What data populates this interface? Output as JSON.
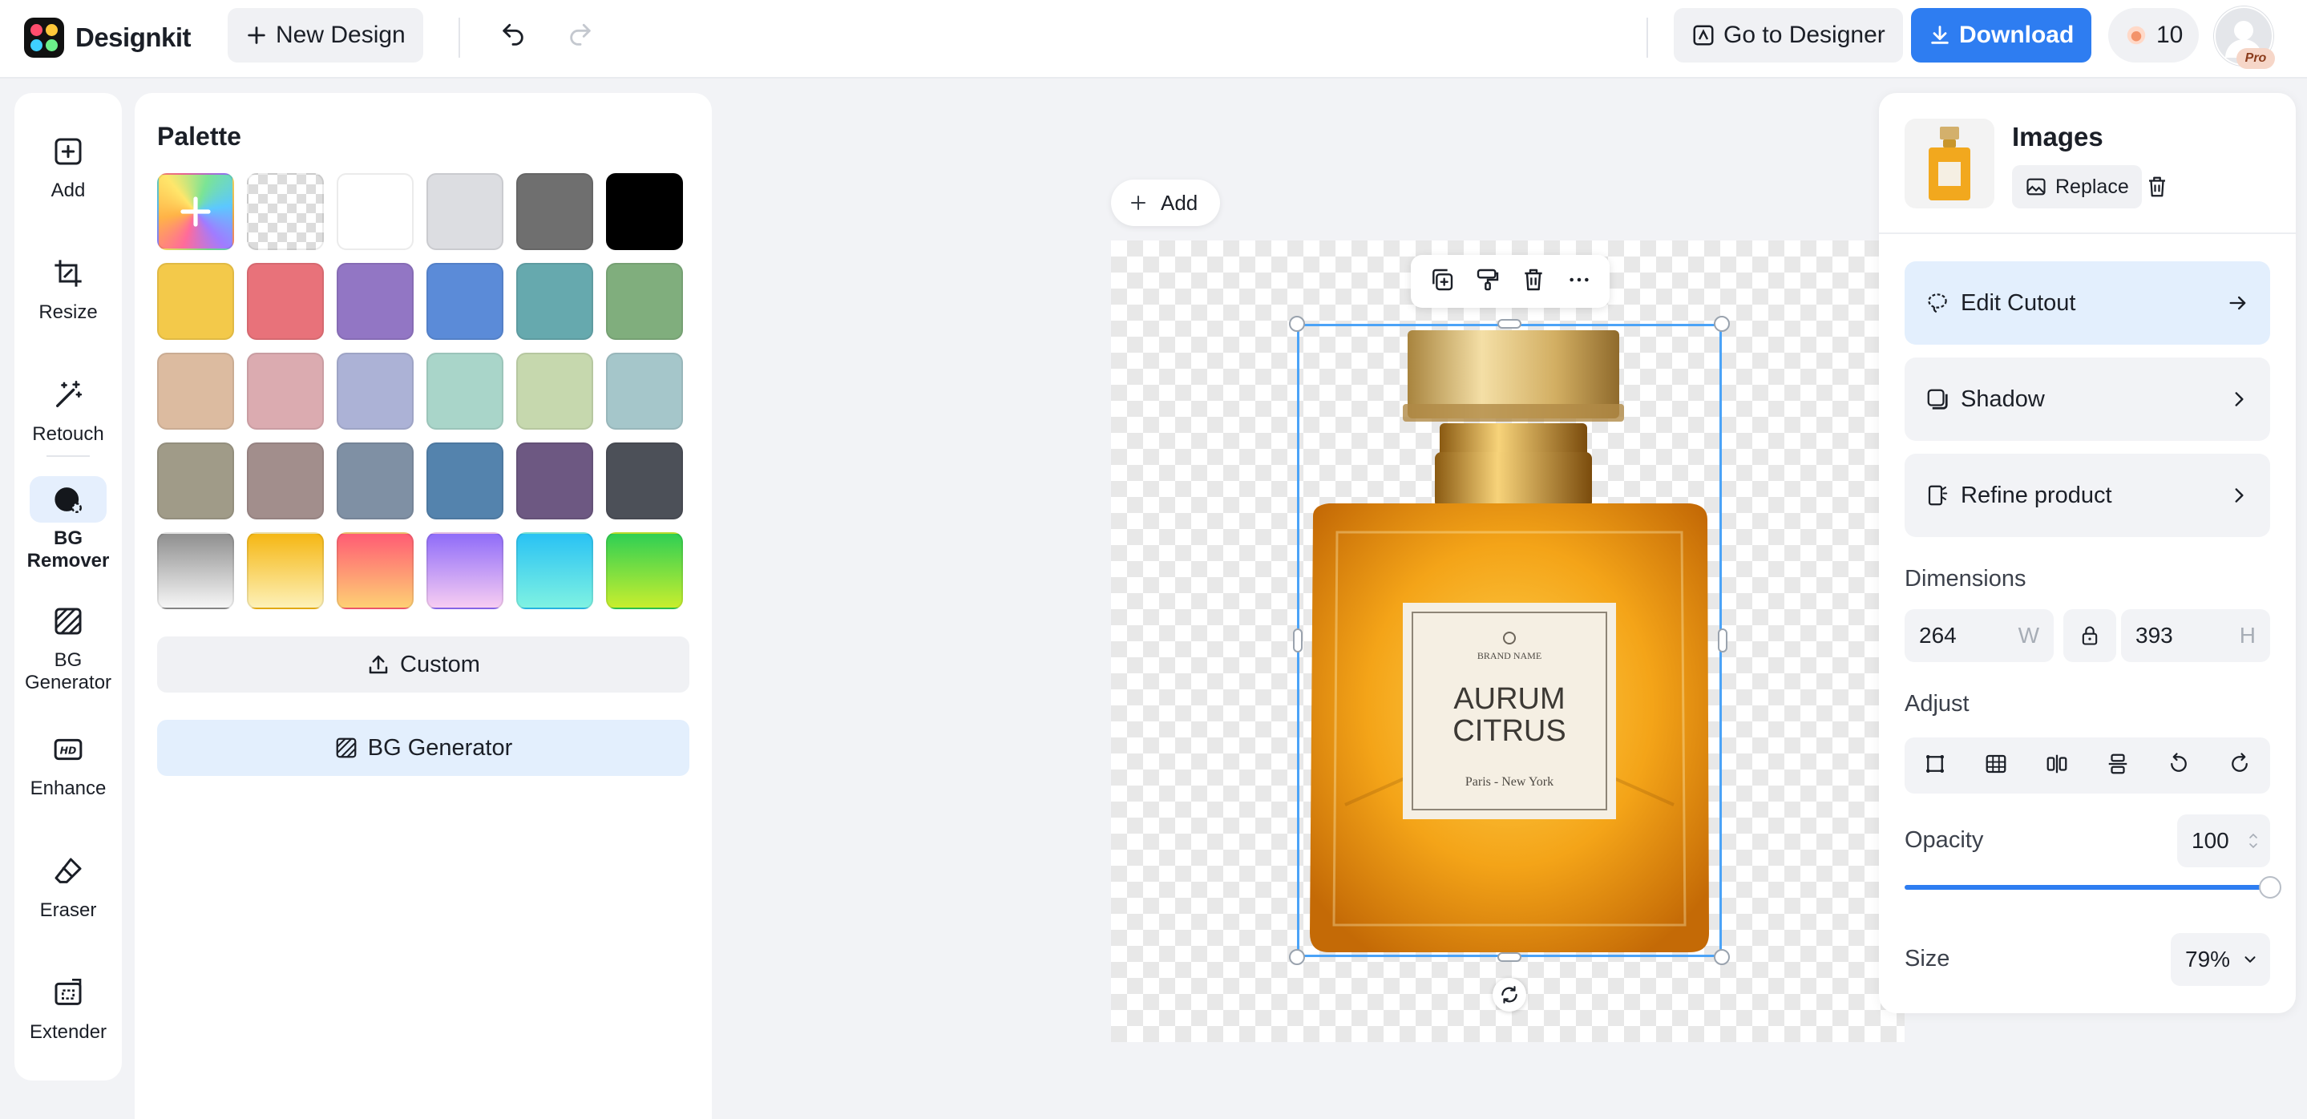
{
  "header": {
    "app_name": "Designkit",
    "new_design_label": "New Design",
    "go_to_designer_label": "Go to Designer",
    "download_label": "Download",
    "credits": "10",
    "plan_badge": "Pro"
  },
  "rail": {
    "items": [
      {
        "label": "Add",
        "icon": "add-icon"
      },
      {
        "label": "Resize",
        "icon": "resize-icon"
      },
      {
        "label": "Retouch",
        "icon": "magic-wand-icon"
      },
      {
        "label": "BG Remover",
        "icon": "bg-remover-icon"
      },
      {
        "label": "BG Generator",
        "icon": "bg-generator-icon"
      },
      {
        "label": "Enhance",
        "icon": "hd-icon"
      },
      {
        "label": "Eraser",
        "icon": "eraser-icon"
      },
      {
        "label": "Extender",
        "icon": "extender-icon"
      }
    ],
    "active": "BG Remover"
  },
  "palette": {
    "title": "Palette",
    "swatches": [
      "add-custom",
      "transparent",
      "#ffffff",
      "#dcdde1",
      "#6f6f6f",
      "#000000",
      "#f3c94a",
      "#e8727a",
      "#9276c4",
      "#5b8bd8",
      "#66a9ae",
      "#80ae7d",
      "#dcbba0",
      "#dbabb0",
      "#acb2d6",
      "#a9d5c9",
      "#c6d8ae",
      "#a5c6ca",
      "#a09b88",
      "#a28e8c",
      "#7f90a4",
      "#5483ad",
      "#6d5882",
      "#4c5058",
      "linear-gradient(180deg,#8f8f8f,#f6f6f6)",
      "linear-gradient(180deg,#f5b714,#fdf1b8)",
      "linear-gradient(180deg,#ff5c74,#fed074)",
      "linear-gradient(180deg,#8f6cf9,#f7cdf2)",
      "linear-gradient(180deg,#29c2f4,#7ff2e2)",
      "linear-gradient(180deg,#2fcf54,#c8ee2e)"
    ],
    "custom_label": "Custom",
    "bg_generator_label": "BG Generator"
  },
  "canvas": {
    "add_label": "Add",
    "product": {
      "brand_line": "BRAND NAME",
      "name_line1": "AURUM",
      "name_line2": "CITRUS",
      "origin": "Paris - New York"
    }
  },
  "properties": {
    "title": "Images",
    "replace_label": "Replace",
    "edit_cutout_label": "Edit Cutout",
    "shadow_label": "Shadow",
    "refine_label": "Refine product",
    "dimensions_label": "Dimensions",
    "width": "264",
    "width_unit": "W",
    "height": "393",
    "height_unit": "H",
    "adjust_label": "Adjust",
    "opacity_label": "Opacity",
    "opacity_value": "100",
    "opacity_level": 100,
    "size_label": "Size",
    "size_value": "79%"
  },
  "colors": {
    "accent": "#2e7df1",
    "selection": "#4ba3f7"
  }
}
